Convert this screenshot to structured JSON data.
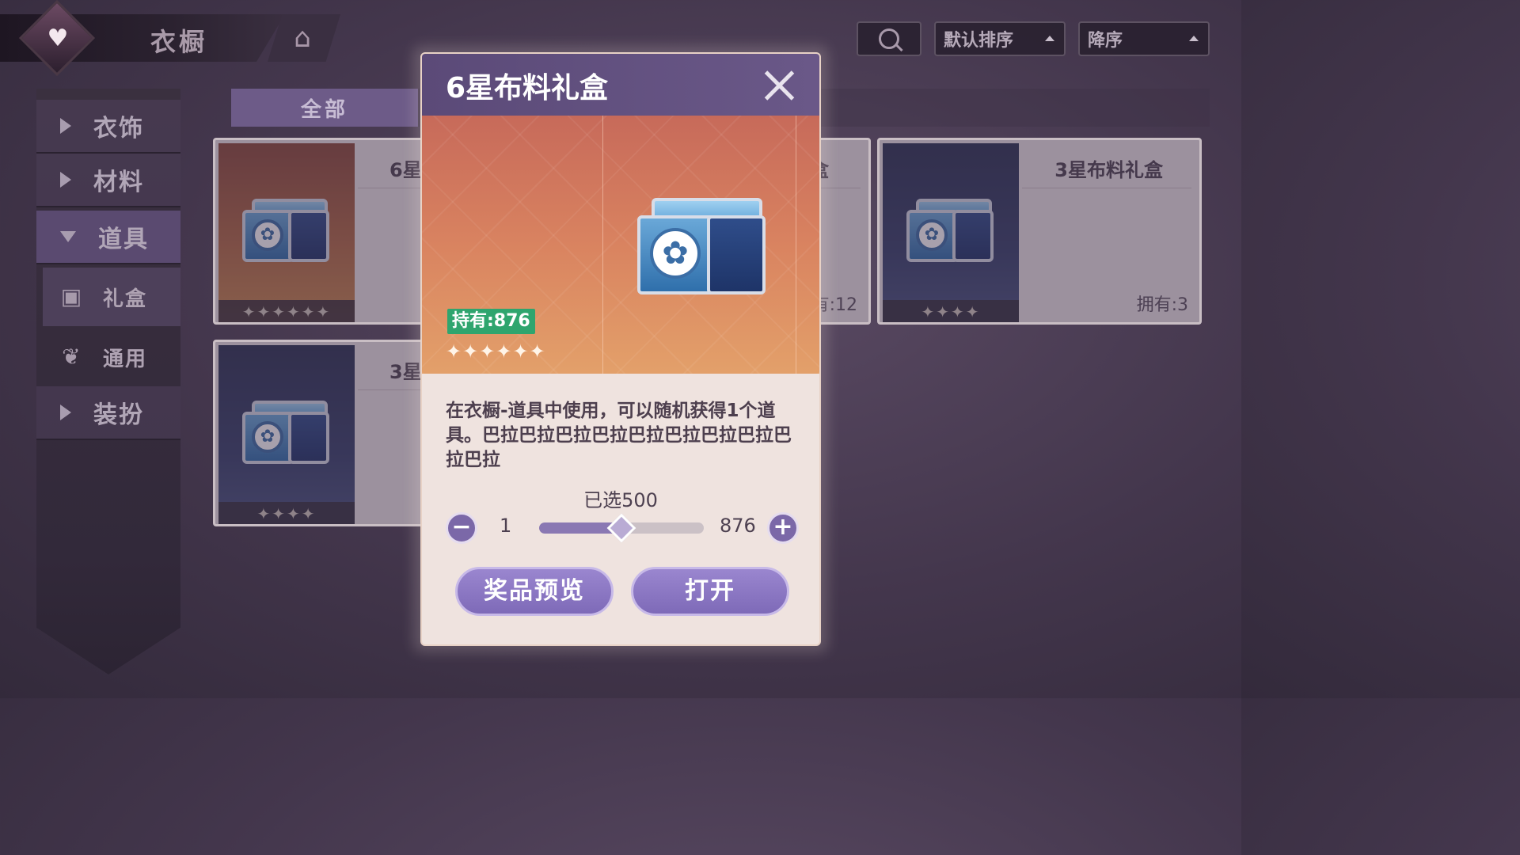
{
  "header": {
    "title": "衣橱",
    "emblem_icon": "heart-crest-icon",
    "home_icon": "home-icon"
  },
  "toolbar": {
    "search_icon": "search-icon",
    "sort_label": "默认排序",
    "order_label": "降序"
  },
  "sidebar": {
    "items": [
      {
        "label": "衣饰",
        "expanded": false
      },
      {
        "label": "材料",
        "expanded": false
      },
      {
        "label": "道具",
        "expanded": true
      },
      {
        "label": "装扮",
        "expanded": false
      }
    ],
    "subitems": [
      {
        "label": "礼盒",
        "icon": "giftbox-icon",
        "active": true
      },
      {
        "label": "通用",
        "icon": "sprout-icon",
        "active": false
      }
    ]
  },
  "filter": {
    "tab_label": "全部"
  },
  "cards": [
    {
      "name": "6星",
      "stars": "✦✦✦✦✦✦",
      "count": "",
      "art": "orange"
    },
    {
      "name": "盒",
      "stars": "",
      "count": "有:12",
      "art": "none"
    },
    {
      "name": "3星布料礼盒",
      "stars": "✦✦✦✦",
      "count": "拥有:3",
      "art": "blue"
    },
    {
      "name": "3星",
      "stars": "✦✦✦✦",
      "count": "",
      "art": "blue"
    }
  ],
  "modal": {
    "title": "6星布料礼盒",
    "owned_badge": "持有:876",
    "stars": "✦✦✦✦✦✦",
    "description": "在衣橱-道具中使用，可以随机获得1个道具。巴拉巴拉巴拉巴拉巴拉巴拉巴拉巴拉巴拉巴拉",
    "selected_label": "已选500",
    "min": "1",
    "max": "876",
    "selected_fraction": 0.5,
    "minus_label": "−",
    "plus_label": "+",
    "preview_button": "奖品预览",
    "open_button": "打开",
    "colors": {
      "accent": "#7b68a8",
      "owned_badge": "#2fa56e"
    }
  }
}
